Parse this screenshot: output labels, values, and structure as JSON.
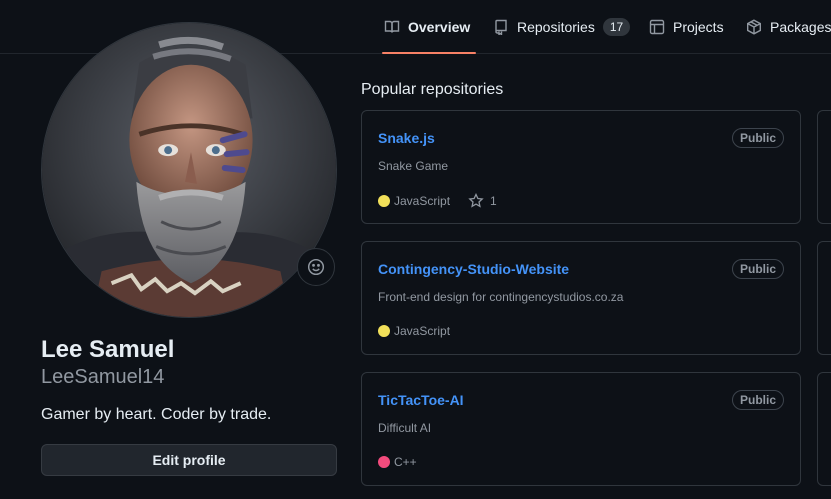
{
  "nav": {
    "tabs": [
      {
        "label": "Overview",
        "icon": "book-icon",
        "active": true
      },
      {
        "label": "Repositories",
        "icon": "repo-icon",
        "count": "17"
      },
      {
        "label": "Projects",
        "icon": "table-icon"
      },
      {
        "label": "Packages",
        "icon": "package-icon"
      }
    ]
  },
  "profile": {
    "full_name": "Lee Samuel",
    "username": "LeeSamuel14",
    "bio": "Gamer by heart. Coder by trade.",
    "edit_label": "Edit profile",
    "status_icon": "smiley-icon"
  },
  "popular": {
    "title": "Popular repositories",
    "repos": [
      {
        "name": "Snake.js",
        "visibility": "Public",
        "description": "Snake Game",
        "language": "JavaScript",
        "language_color": "#f1e05a",
        "stars": "1"
      },
      {
        "name": "Contingency-Studio-Website",
        "visibility": "Public",
        "description": "Front-end design for contingencystudios.co.za",
        "language": "JavaScript",
        "language_color": "#f1e05a"
      },
      {
        "name": "TicTacToe-AI",
        "visibility": "Public",
        "description": "Difficult AI",
        "language": "C++",
        "language_color": "#f34b7d"
      }
    ]
  },
  "colors": {
    "accent": "#f78166",
    "link": "#4493f8",
    "background": "#0d1117"
  }
}
